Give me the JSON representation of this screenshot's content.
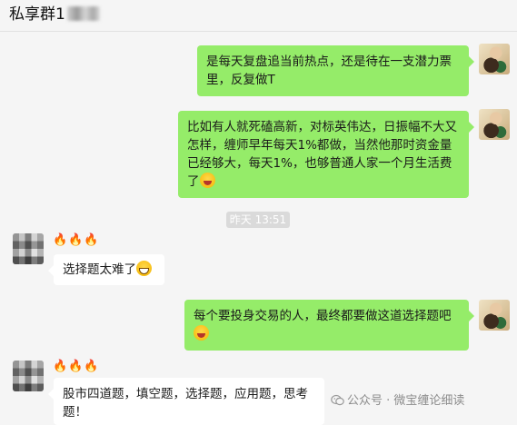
{
  "window": {
    "title": "私享群1"
  },
  "messages": [
    {
      "sender": "self",
      "text": "是每天复盘追当前热点，还是待在一支潜力票里，反复做T"
    },
    {
      "sender": "self",
      "text": "比如有人就死磕高新，对标英伟达，日振幅不大又怎样，缠师早年每天1%都做，当然他那时资金量已经够大，每天1%，也够普通人家一个月生活费了",
      "emoji": "laughing-crying-emoji"
    },
    {
      "type": "timestamp",
      "text": "昨天 13:51"
    },
    {
      "sender": "other",
      "nickname": "🔥🔥🔥",
      "text": "选择题太难了",
      "emoji": "grinning-emoji"
    },
    {
      "sender": "self",
      "text": "每个要投身交易的人，最终都要做这道选择题吧",
      "emoji": "laughing-crying-emoji"
    },
    {
      "sender": "other",
      "nickname": "🔥🔥🔥",
      "text": "股市四道题，填空题，选择题，应用题，思考题！"
    }
  ],
  "watermark": {
    "text": "公众号 · 微宝缠论细读",
    "icon": "wechat-official-account-icon"
  }
}
